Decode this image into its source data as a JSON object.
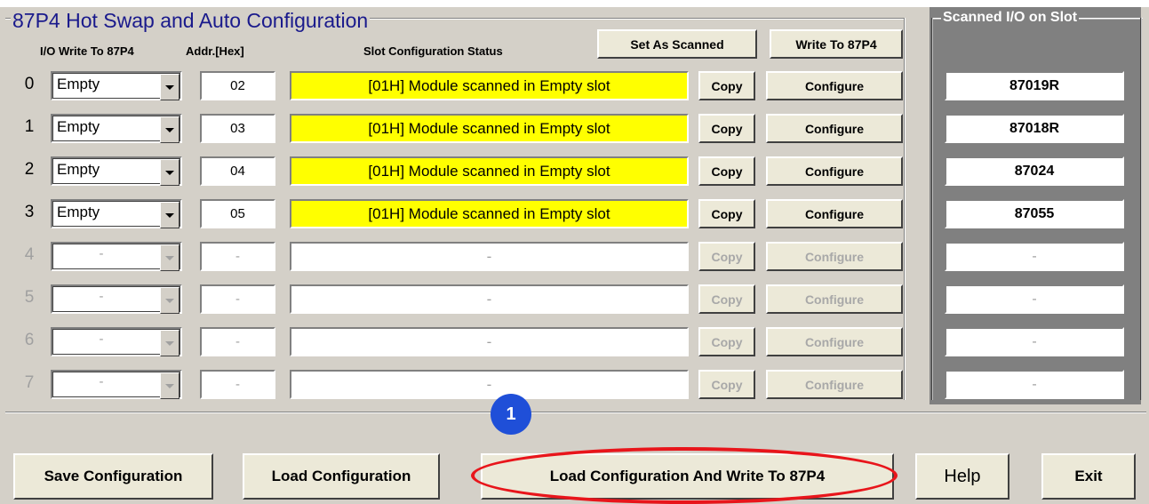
{
  "main": {
    "title": "87P4 Hot Swap and Auto Configuration",
    "headers": {
      "io_write": "I/O Write To 87P4",
      "addr": "Addr.[Hex]",
      "status": "Slot Configuration Status"
    },
    "set_as_scanned_label": "Set As Scanned",
    "write_to_87p4_label": "Write To 87P4"
  },
  "slots": [
    {
      "num": "0",
      "io": "Empty",
      "addr": "02",
      "status": "[01H] Module scanned in Empty slot",
      "copy": "Copy",
      "configure": "Configure",
      "scanned": "87019R"
    },
    {
      "num": "1",
      "io": "Empty",
      "addr": "03",
      "status": "[01H] Module scanned in Empty slot",
      "copy": "Copy",
      "configure": "Configure",
      "scanned": "87018R"
    },
    {
      "num": "2",
      "io": "Empty",
      "addr": "04",
      "status": "[01H] Module scanned in Empty slot",
      "copy": "Copy",
      "configure": "Configure",
      "scanned": "87024"
    },
    {
      "num": "3",
      "io": "Empty",
      "addr": "05",
      "status": "[01H] Module scanned in Empty slot",
      "copy": "Copy",
      "configure": "Configure",
      "scanned": "87055"
    },
    {
      "num": "4",
      "io": "-",
      "addr": "-",
      "status": "-",
      "copy": "Copy",
      "configure": "Configure",
      "scanned": "-"
    },
    {
      "num": "5",
      "io": "-",
      "addr": "-",
      "status": "-",
      "copy": "Copy",
      "configure": "Configure",
      "scanned": "-"
    },
    {
      "num": "6",
      "io": "-",
      "addr": "-",
      "status": "-",
      "copy": "Copy",
      "configure": "Configure",
      "scanned": "-"
    },
    {
      "num": "7",
      "io": "-",
      "addr": "-",
      "status": "-",
      "copy": "Copy",
      "configure": "Configure",
      "scanned": "-"
    }
  ],
  "scanned_panel": {
    "title": "Scanned I/O on Slot"
  },
  "bottom": {
    "save_label": "Save Configuration",
    "load_label": "Load Configuration",
    "load_write_label": "Load  Configuration And Write To 87P4",
    "help_label": "Help",
    "exit_label": "Exit"
  },
  "annotation": {
    "badge": "1",
    "badge_color": "#1f4fd8",
    "highlight_color": "#e8151b"
  },
  "colors": {
    "status_highlight": "#ffff00",
    "title_text": "#1a1a8c"
  }
}
